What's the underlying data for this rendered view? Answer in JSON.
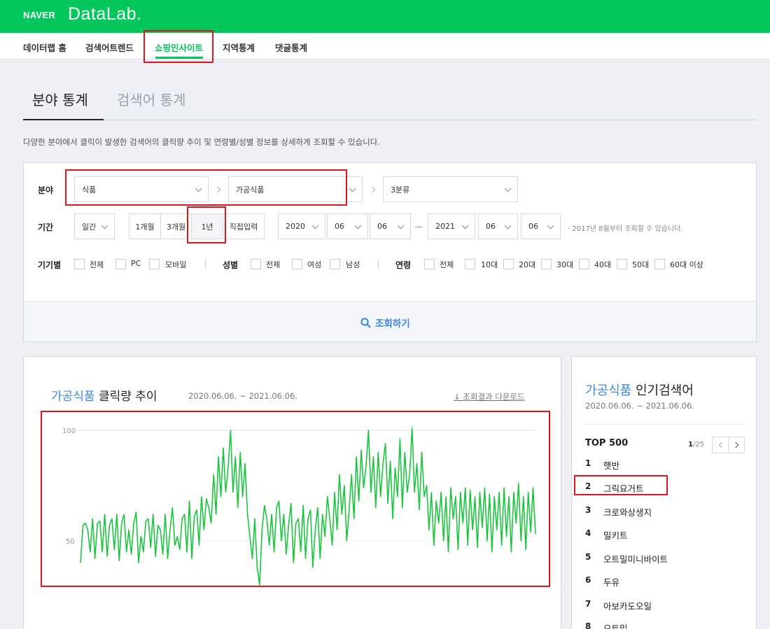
{
  "header": {
    "brand": "NAVER",
    "product": "DataLab."
  },
  "nav": {
    "items": [
      "데이터랩 홈",
      "검색어트렌드",
      "쇼핑인사이트",
      "지역통계",
      "댓글통계"
    ],
    "active_index": 2
  },
  "section": {
    "tabs": [
      "분야 통계",
      "검색어 통계"
    ],
    "description": "다양한 분야에서 클릭이 발생한 검색어의 클릭량 추이 및 연령별/성별 정보를 상세하게 조회할 수 있습니다."
  },
  "filters": {
    "category_label": "분야",
    "category1": "식품",
    "category2": "가공식품",
    "category3": "3분류",
    "period_label": "기간",
    "period_unit": "일간",
    "period_buttons": [
      "1개월",
      "3개월",
      "1년",
      "직접입력"
    ],
    "period_active": "1년",
    "start": {
      "year": "2020",
      "month": "06",
      "day": "06"
    },
    "end": {
      "year": "2021",
      "month": "06",
      "day": "06"
    },
    "note": "· 2017년 8월부터 조회할 수 있습니다.",
    "device_label": "기기별",
    "device_options": [
      "전체",
      "PC",
      "모바일"
    ],
    "gender_label": "성별",
    "gender_options": [
      "전체",
      "여성",
      "남성"
    ],
    "age_label": "연령",
    "age_options": [
      "전체",
      "10대",
      "20대",
      "30대",
      "40대",
      "50대",
      "60대 이상"
    ],
    "search_button": "조회하기"
  },
  "chart_card": {
    "title_category": "가공식품",
    "title_metric": "클릭량 추이",
    "date_range": "2020.06.06. ~ 2021.06.06.",
    "download": "조회결과 다운로드"
  },
  "chart_data": {
    "type": "line",
    "ylim": [
      25,
      100
    ],
    "y_ticks": [
      100,
      50
    ],
    "grid": true,
    "x_start": "2020-06-06",
    "x_end": "2021-06-06",
    "series": [
      {
        "values": [
          40,
          57,
          58,
          55,
          45,
          60,
          42,
          58,
          59,
          45,
          62,
          43,
          57,
          60,
          46,
          62,
          41,
          58,
          62,
          45,
          55,
          44,
          58,
          63,
          40,
          52,
          45,
          59,
          60,
          47,
          62,
          43,
          57,
          55,
          44,
          62,
          42,
          55,
          65,
          48,
          52,
          46,
          60,
          62,
          45,
          68,
          42,
          61,
          64,
          48,
          70,
          55,
          69,
          65,
          58,
          80,
          62,
          88,
          70,
          92,
          72,
          83,
          100,
          72,
          88,
          65,
          90,
          70,
          85,
          62,
          52,
          42,
          60,
          38,
          30,
          55,
          66,
          60,
          48,
          62,
          45,
          65,
          68,
          50,
          62,
          44,
          57,
          67,
          40,
          58,
          60,
          45,
          66,
          42,
          60,
          64,
          38,
          55,
          65,
          42,
          62,
          52,
          70,
          60,
          48,
          72,
          55,
          80,
          62,
          75,
          50,
          64,
          80,
          60,
          88,
          68,
          91,
          74,
          84,
          100,
          72,
          88,
          65,
          90,
          70,
          85,
          94,
          67,
          86,
          60,
          83,
          70,
          96,
          65,
          90,
          72,
          80,
          101,
          72,
          85,
          64,
          90,
          70,
          75,
          55,
          72,
          48,
          68,
          58,
          72,
          50,
          70,
          45,
          74,
          60,
          70,
          46,
          72,
          58,
          74,
          48,
          73,
          55,
          70,
          47,
          72,
          56,
          74,
          50,
          71,
          45,
          70,
          55,
          72,
          48,
          74,
          52,
          70,
          45,
          72,
          58,
          76,
          50,
          70,
          46,
          72,
          54,
          74,
          53
        ]
      }
    ]
  },
  "popular": {
    "title_category": "가공식품",
    "title_suffix": "인기검색어",
    "date_range": "2020.06.06. ~ 2021.06.06.",
    "top_label": "TOP 500",
    "page_current": "1",
    "page_total": "/25",
    "items": [
      {
        "rank": "1",
        "keyword": "햇반"
      },
      {
        "rank": "2",
        "keyword": "그릭요거트"
      },
      {
        "rank": "3",
        "keyword": "크로와상생지"
      },
      {
        "rank": "4",
        "keyword": "밀키트"
      },
      {
        "rank": "5",
        "keyword": "오트밀미니바이트"
      },
      {
        "rank": "6",
        "keyword": "두유"
      },
      {
        "rank": "7",
        "keyword": "아보카도오일"
      },
      {
        "rank": "8",
        "keyword": "오트밀"
      }
    ]
  }
}
